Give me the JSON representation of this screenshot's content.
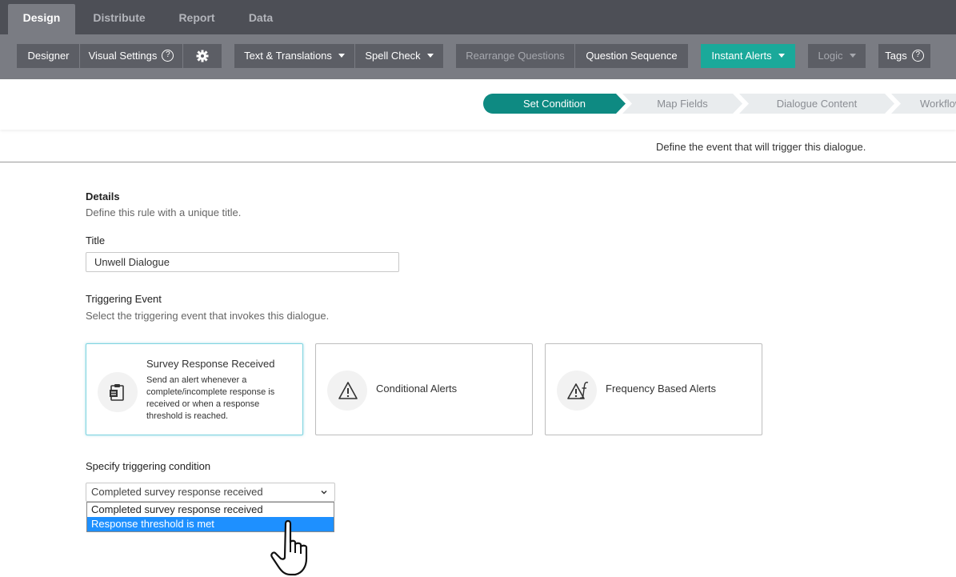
{
  "top_tabs": [
    {
      "label": "Design",
      "active": true
    },
    {
      "label": "Distribute",
      "active": false
    },
    {
      "label": "Report",
      "active": false
    },
    {
      "label": "Data",
      "active": false
    }
  ],
  "toolbar": {
    "designer": "Designer",
    "visual_settings": "Visual Settings",
    "text_translations": "Text & Translations",
    "spell_check": "Spell Check",
    "rearrange_questions": "Rearrange Questions",
    "question_sequence": "Question Sequence",
    "instant_alerts": "Instant Alerts",
    "logic": "Logic",
    "tags": "Tags",
    "help_glyph": "?"
  },
  "wizard": {
    "steps": [
      "Set Condition",
      "Map Fields",
      "Dialogue Content",
      "Workflow"
    ],
    "active_index": 0,
    "hint": "Define the event that will trigger this dialogue."
  },
  "details": {
    "heading": "Details",
    "description": "Define this rule with a unique title.",
    "title_label": "Title",
    "title_value": "Unwell Dialogue"
  },
  "triggering": {
    "heading": "Triggering Event",
    "description": "Select the triggering event that invokes this dialogue.",
    "cards": [
      {
        "title": "Survey Response Received",
        "description": "Send an alert whenever a complete/incomplete response is received or when a response threshold is reached.",
        "icon": "clipboard-icon",
        "selected": true
      },
      {
        "title": "Conditional Alerts",
        "icon": "warning-icon",
        "selected": false
      },
      {
        "title": "Frequency Based Alerts",
        "icon": "warning-function-icon",
        "selected": false
      }
    ]
  },
  "condition": {
    "heading": "Specify triggering condition",
    "selected": "Completed survey response received",
    "options": [
      "Completed survey response received",
      "Response threshold is met"
    ],
    "highlighted_index": 1
  },
  "colors": {
    "accent_teal": "#1aa99a",
    "wizard_active": "#0e8a82",
    "dropdown_highlight": "#1e90ff",
    "topbar": "#4d4f56",
    "toolbar": "#7a7c83"
  }
}
